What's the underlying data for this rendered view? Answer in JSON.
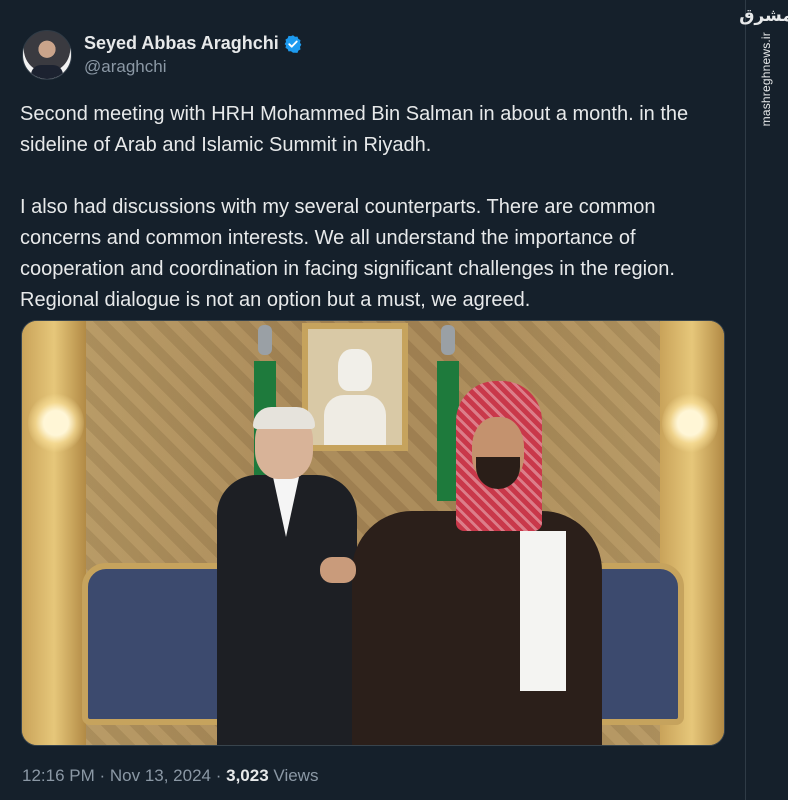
{
  "author": {
    "display_name": "Seyed Abbas Araghchi",
    "handle": "@araghchi",
    "verified": true,
    "verified_color": "#1d9bf0"
  },
  "tweet": {
    "paragraphs": [
      "Second meeting with HRH Mohammed Bin Salman in about a month. in the sideline of Arab and Islamic Summit in Riyadh.",
      "I also had discussions with my several counterparts. There are common concerns and common interests. We all understand the importance of cooperation and coordination in facing significant challenges in the region. Regional dialogue is not an option but a must, we agreed."
    ],
    "photo_alt": "Handshake photo"
  },
  "meta": {
    "time": "12:16 PM",
    "date": "Nov 13, 2024",
    "view_count": "3,023",
    "views_label": "Views"
  },
  "watermark": {
    "logo": "مشرق",
    "url": "mashreghnews.ir"
  },
  "colors": {
    "background": "#15202b",
    "text": "#e7e9ea",
    "muted": "#8b98a5"
  },
  "icons": {
    "verified": "verified-badge-icon"
  }
}
